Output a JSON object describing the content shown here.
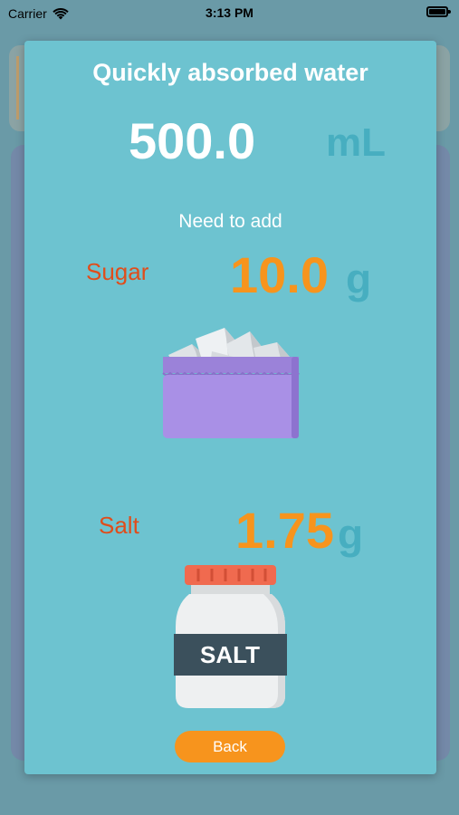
{
  "status_bar": {
    "carrier": "Carrier",
    "time": "3:13 PM",
    "wifi_icon": "wifi-icon",
    "battery_icon": "battery-icon"
  },
  "modal": {
    "title": "Quickly absorbed water",
    "volume": "500.0",
    "volume_unit": "mL",
    "subtitle": "Need to add",
    "sugar": {
      "label": "Sugar",
      "amount": "10.0",
      "unit": "g",
      "icon": "sugar-cubes-icon"
    },
    "salt": {
      "label": "Salt",
      "amount": "1.75",
      "unit": "g",
      "icon": "salt-jar-icon",
      "jar_text": "SALT"
    },
    "back_label": "Back"
  },
  "colors": {
    "modal_bg": "#6dc3d0",
    "white_text": "#ffffff",
    "unit_teal": "#47aec0",
    "label_red": "#e04d1b",
    "amount_orange": "#f7941d",
    "button_orange": "#f7941d"
  }
}
